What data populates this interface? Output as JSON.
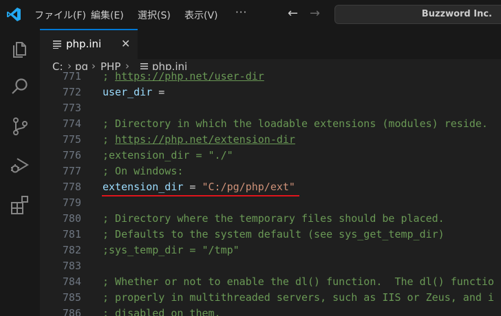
{
  "titlebar": {
    "menus": [
      "ファイル(F)",
      "編集(E)",
      "選択(S)",
      "表示(V)"
    ],
    "more": "···",
    "back": "←",
    "forward": "→",
    "search_text": "Buzzword Inc."
  },
  "tab": {
    "label": "php.ini",
    "close": "✕"
  },
  "breadcrumb": {
    "drive": "C:",
    "folder1": "pg",
    "folder2": "PHP",
    "file": "php.ini",
    "sep": "›"
  },
  "editor": {
    "lines": [
      {
        "n": "771",
        "p": [
          {
            "t": "; ",
            "c": "cm"
          },
          {
            "t": "https://php.net/user-dir",
            "c": "lnk"
          }
        ]
      },
      {
        "n": "772",
        "p": [
          {
            "t": "user_dir",
            "c": "key"
          },
          {
            "t": " =",
            "c": "op"
          }
        ]
      },
      {
        "n": "773",
        "p": []
      },
      {
        "n": "774",
        "p": [
          {
            "t": "; Directory in which the loadable extensions (modules) reside.",
            "c": "cm"
          }
        ]
      },
      {
        "n": "775",
        "p": [
          {
            "t": "; ",
            "c": "cm"
          },
          {
            "t": "https://php.net/extension-dir",
            "c": "lnk"
          }
        ]
      },
      {
        "n": "776",
        "p": [
          {
            "t": ";extension_dir = \"./\"",
            "c": "cm"
          }
        ]
      },
      {
        "n": "777",
        "p": [
          {
            "t": "; On windows:",
            "c": "cm"
          }
        ]
      },
      {
        "n": "778",
        "p": [
          {
            "t": "extension_dir",
            "c": "key"
          },
          {
            "t": " = ",
            "c": "op"
          },
          {
            "t": "\"C:/pg/php/ext\"",
            "c": "str"
          }
        ]
      },
      {
        "n": "779",
        "p": []
      },
      {
        "n": "780",
        "p": [
          {
            "t": "; Directory where the temporary files should be placed.",
            "c": "cm"
          }
        ]
      },
      {
        "n": "781",
        "p": [
          {
            "t": "; Defaults to the system default (see sys_get_temp_dir)",
            "c": "cm"
          }
        ]
      },
      {
        "n": "782",
        "p": [
          {
            "t": ";sys_temp_dir = \"/tmp\"",
            "c": "cm"
          }
        ]
      },
      {
        "n": "783",
        "p": []
      },
      {
        "n": "784",
        "p": [
          {
            "t": "; Whether or not to enable the dl() function.  The dl() functio",
            "c": "cm"
          }
        ]
      },
      {
        "n": "785",
        "p": [
          {
            "t": "; properly in multithreaded servers, such as IIS or Zeus, and i",
            "c": "cm"
          }
        ]
      },
      {
        "n": "786",
        "p": [
          {
            "t": "; disabled on them.",
            "c": "cm"
          }
        ]
      }
    ]
  },
  "colors": {
    "accent": "#0078d4",
    "highlight": "#e0141c",
    "comment": "#6a9955",
    "key": "#9cdcfe",
    "string": "#ce9178"
  },
  "icons": [
    "vscode-logo-icon",
    "explorer-icon",
    "search-icon",
    "source-control-icon",
    "run-debug-icon",
    "extensions-icon",
    "file-lines-icon"
  ]
}
